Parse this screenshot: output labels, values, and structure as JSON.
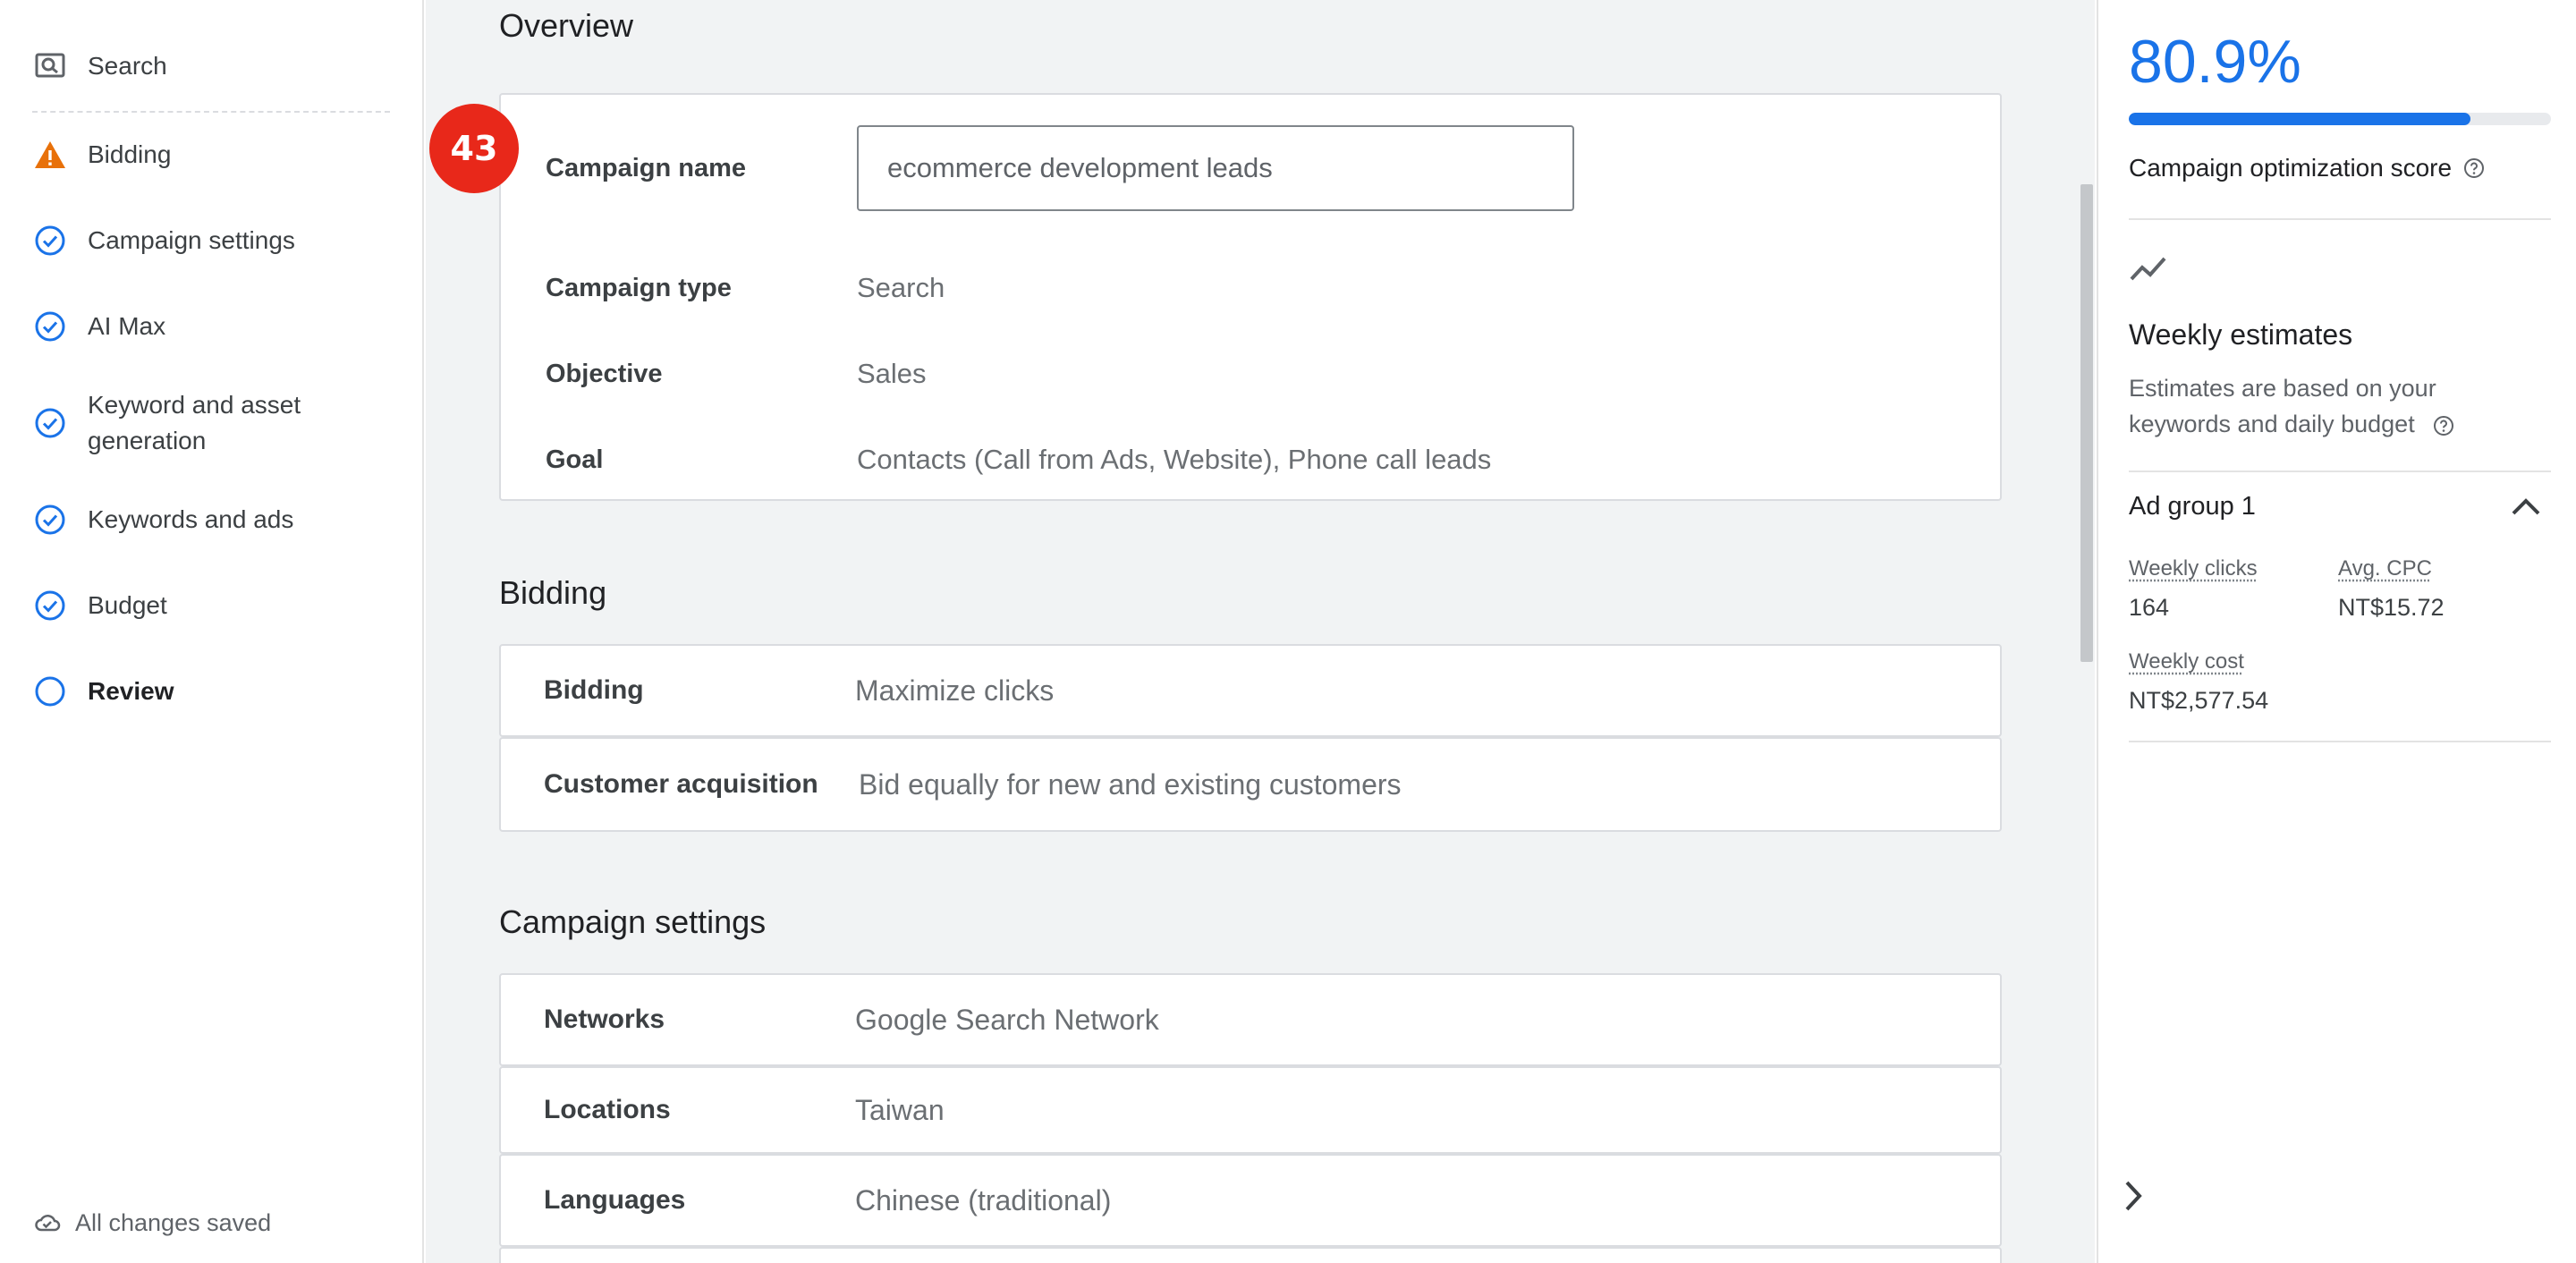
{
  "sidebar": {
    "items": [
      {
        "label": "Search",
        "icon": "search-icon"
      },
      {
        "label": "Bidding",
        "icon": "warning-icon"
      },
      {
        "label": "Campaign settings",
        "icon": "check-circle-icon"
      },
      {
        "label": "AI Max",
        "icon": "check-circle-icon"
      },
      {
        "label": "Keyword and asset generation",
        "icon": "check-circle-icon"
      },
      {
        "label": "Keywords and ads",
        "icon": "check-circle-icon"
      },
      {
        "label": "Budget",
        "icon": "check-circle-icon"
      },
      {
        "label": "Review",
        "icon": "empty-circle-icon"
      }
    ],
    "status": "All changes saved"
  },
  "overview": {
    "title": "Overview",
    "badge": "43",
    "campaign_name_label": "Campaign name",
    "campaign_name_value": "ecommerce development leads",
    "rows": [
      {
        "label": "Campaign type",
        "value": "Search"
      },
      {
        "label": "Objective",
        "value": "Sales"
      },
      {
        "label": "Goal",
        "value": "Contacts (Call from Ads, Website), Phone call leads"
      }
    ]
  },
  "bidding": {
    "title": "Bidding",
    "rows": [
      {
        "label": "Bidding",
        "value": "Maximize clicks"
      },
      {
        "label": "Customer acquisition",
        "value": "Bid equally for new and existing customers"
      }
    ]
  },
  "campaign_settings": {
    "title": "Campaign settings",
    "rows": [
      {
        "label": "Networks",
        "value": "Google Search Network"
      },
      {
        "label": "Locations",
        "value": "Taiwan"
      },
      {
        "label": "Languages",
        "value": "Chinese (traditional)"
      }
    ]
  },
  "right_panel": {
    "score": "80.9%",
    "score_fraction": 0.809,
    "score_label": "Campaign optimization score",
    "weekly_title": "Weekly estimates",
    "weekly_subtitle": "Estimates are based on your keywords and daily budget",
    "ad_group": "Ad group 1",
    "metrics": {
      "weekly_clicks_label": "Weekly clicks",
      "weekly_clicks_value": "164",
      "avg_cpc_label": "Avg. CPC",
      "avg_cpc_value": "NT$15.72",
      "weekly_cost_label": "Weekly cost",
      "weekly_cost_value": "NT$2,577.54"
    }
  },
  "colors": {
    "accent": "#1a73e8",
    "warning": "#e8710a",
    "badge": "#e8281a"
  }
}
